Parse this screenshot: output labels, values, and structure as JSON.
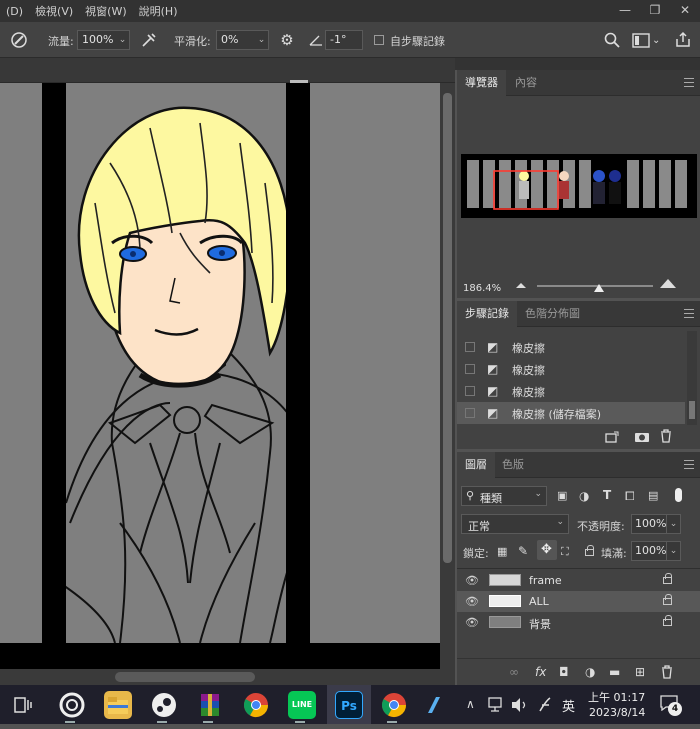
{
  "menu": {
    "items": [
      {
        "label": "(D)"
      },
      {
        "label": "檢視(V)"
      },
      {
        "label": "視窗(W)"
      },
      {
        "label": "說明(H)"
      }
    ]
  },
  "window_controls": {
    "minimize": "—",
    "restore": "❐",
    "close": "✕"
  },
  "options_bar": {
    "flow_label": "流量:",
    "flow_value": "100%",
    "smoothing_label": "平滑化:",
    "smoothing_value": "0%",
    "angle_value": "-1°",
    "erase_history_label": "自步驟記錄"
  },
  "navigator": {
    "tabs": [
      "導覽器",
      "內容"
    ],
    "zoom": "186.4%",
    "zoom_slider_fraction": 0.52
  },
  "history": {
    "tabs": [
      "步驟記錄",
      "色階分佈圖"
    ],
    "items": [
      {
        "label": "橡皮擦"
      },
      {
        "label": "橡皮擦"
      },
      {
        "label": "橡皮擦"
      },
      {
        "label": "橡皮擦 (儲存檔案)"
      }
    ]
  },
  "layers_panel": {
    "tabs": [
      "圖層",
      "色版"
    ],
    "filter_label": "種類",
    "blend_mode": "正常",
    "opacity_label": "不透明度:",
    "opacity_value": "100%",
    "lock_label": "鎖定:",
    "fill_label": "填滿:",
    "fill_value": "100%",
    "layers": [
      {
        "name": "frame"
      },
      {
        "name": "ALL"
      },
      {
        "name": "背景"
      }
    ]
  },
  "taskbar": {
    "ime_label": "英",
    "time": "上午 01:17",
    "date": "2023/8/14",
    "notification_count": "4",
    "apps": [
      "task-view",
      "browser",
      "file-explorer",
      "steam",
      "winrar",
      "chrome",
      "line",
      "photoshop",
      "chrome",
      "other"
    ]
  },
  "colors": {
    "hair": "#fdf8a0",
    "skin": "#fde3c8",
    "eyes": "#1f6be0",
    "canvas_bg": "#7f7f7f",
    "bars": "#000000",
    "ps_accent": "#31a8ff"
  }
}
